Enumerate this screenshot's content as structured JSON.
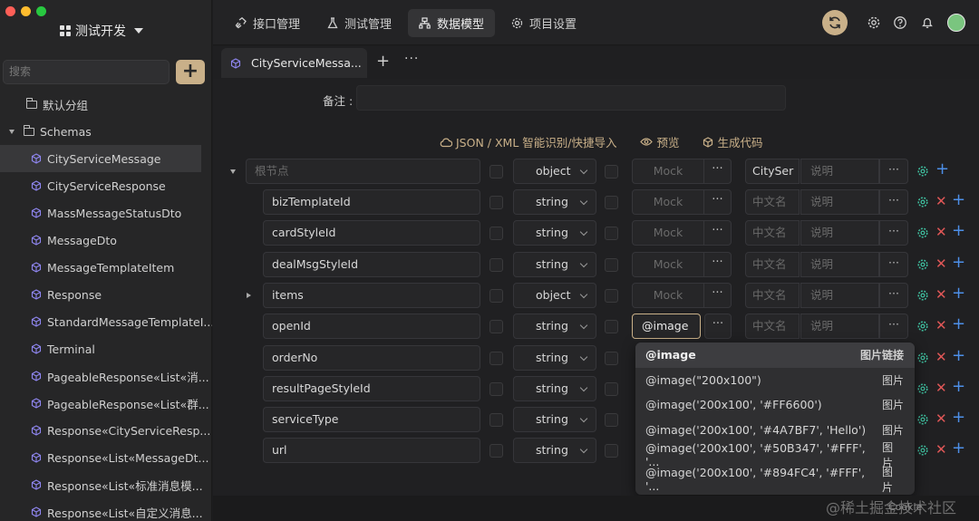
{
  "app": {
    "project_name": "测试开发"
  },
  "sidebar": {
    "search_placeholder": "搜索",
    "add_label": "+",
    "default_group": "默认分组",
    "schemas_label": "Schemas",
    "items": [
      "CityServiceMessage",
      "CityServiceResponse",
      "MassMessageStatusDto",
      "MessageDto",
      "MessageTemplateItem",
      "Response",
      "StandardMessageTemplateI...",
      "Terminal",
      "PageableResponse«List«消...",
      "PageableResponse«List«群...",
      "Response«CityServiceResp...",
      "Response«List«MessageDt...",
      "Response«List«标准消息模...",
      "Response«List«自定义消息..."
    ]
  },
  "topnav": {
    "tabs": [
      "接口管理",
      "测试管理",
      "数据模型",
      "项目设置"
    ],
    "active": "数据模型"
  },
  "doc_tab": {
    "title": "CityServiceMessa...",
    "add": "+",
    "more": "···"
  },
  "form": {
    "remark_label": "备注 :",
    "actions": {
      "import": "JSON / XML 智能识别/快捷导入",
      "preview": "预览",
      "generate": "生成代码"
    }
  },
  "fields": {
    "root": {
      "name_placeholder": "根节点",
      "type": "object",
      "mock": "Mock",
      "cn": "CitySer",
      "desc": "说明"
    },
    "rows": [
      {
        "name": "bizTemplateId",
        "type": "string",
        "mock": "Mock",
        "cn": "中文名",
        "desc": "说明"
      },
      {
        "name": "cardStyleId",
        "type": "string",
        "mock": "Mock",
        "cn": "中文名",
        "desc": "说明"
      },
      {
        "name": "dealMsgStyleId",
        "type": "string",
        "mock": "Mock",
        "cn": "中文名",
        "desc": "说明"
      },
      {
        "name": "items",
        "type": "object",
        "mock": "Mock",
        "cn": "中文名",
        "desc": "说明"
      },
      {
        "name": "openId",
        "type": "string",
        "mock": "@image",
        "cn": "中文名",
        "desc": "说明"
      },
      {
        "name": "orderNo",
        "type": "string",
        "mock": "",
        "cn": "",
        "desc": ""
      },
      {
        "name": "resultPageStyleId",
        "type": "string",
        "mock": "",
        "cn": "",
        "desc": ""
      },
      {
        "name": "serviceType",
        "type": "string",
        "mock": "",
        "cn": "",
        "desc": ""
      },
      {
        "name": "url",
        "type": "string",
        "mock": "",
        "cn": "",
        "desc": ""
      }
    ],
    "more": "···"
  },
  "suggestions": [
    {
      "label": "@image",
      "tag": "图片链接"
    },
    {
      "label": "@image(\"200x100\")",
      "tag": "图片"
    },
    {
      "label": "@image('200x100', '#FF6600')",
      "tag": "图片"
    },
    {
      "label": "@image('200x100', '#4A7BF7', 'Hello')",
      "tag": "图片"
    },
    {
      "label": "@image('200x100', '#50B347', '#FFF', '...",
      "tag": "图片"
    },
    {
      "label": "@image('200x100', '#894FC4', '#FFF', '...",
      "tag": "图片"
    }
  ],
  "watermark": {
    "main": "@稀土掘金技术社区",
    "sub": "Cookie"
  },
  "colors": {
    "accent": "#c9b089",
    "delete": "#e05757",
    "add": "#4d8fe8",
    "gear": "#3fbf9f"
  }
}
